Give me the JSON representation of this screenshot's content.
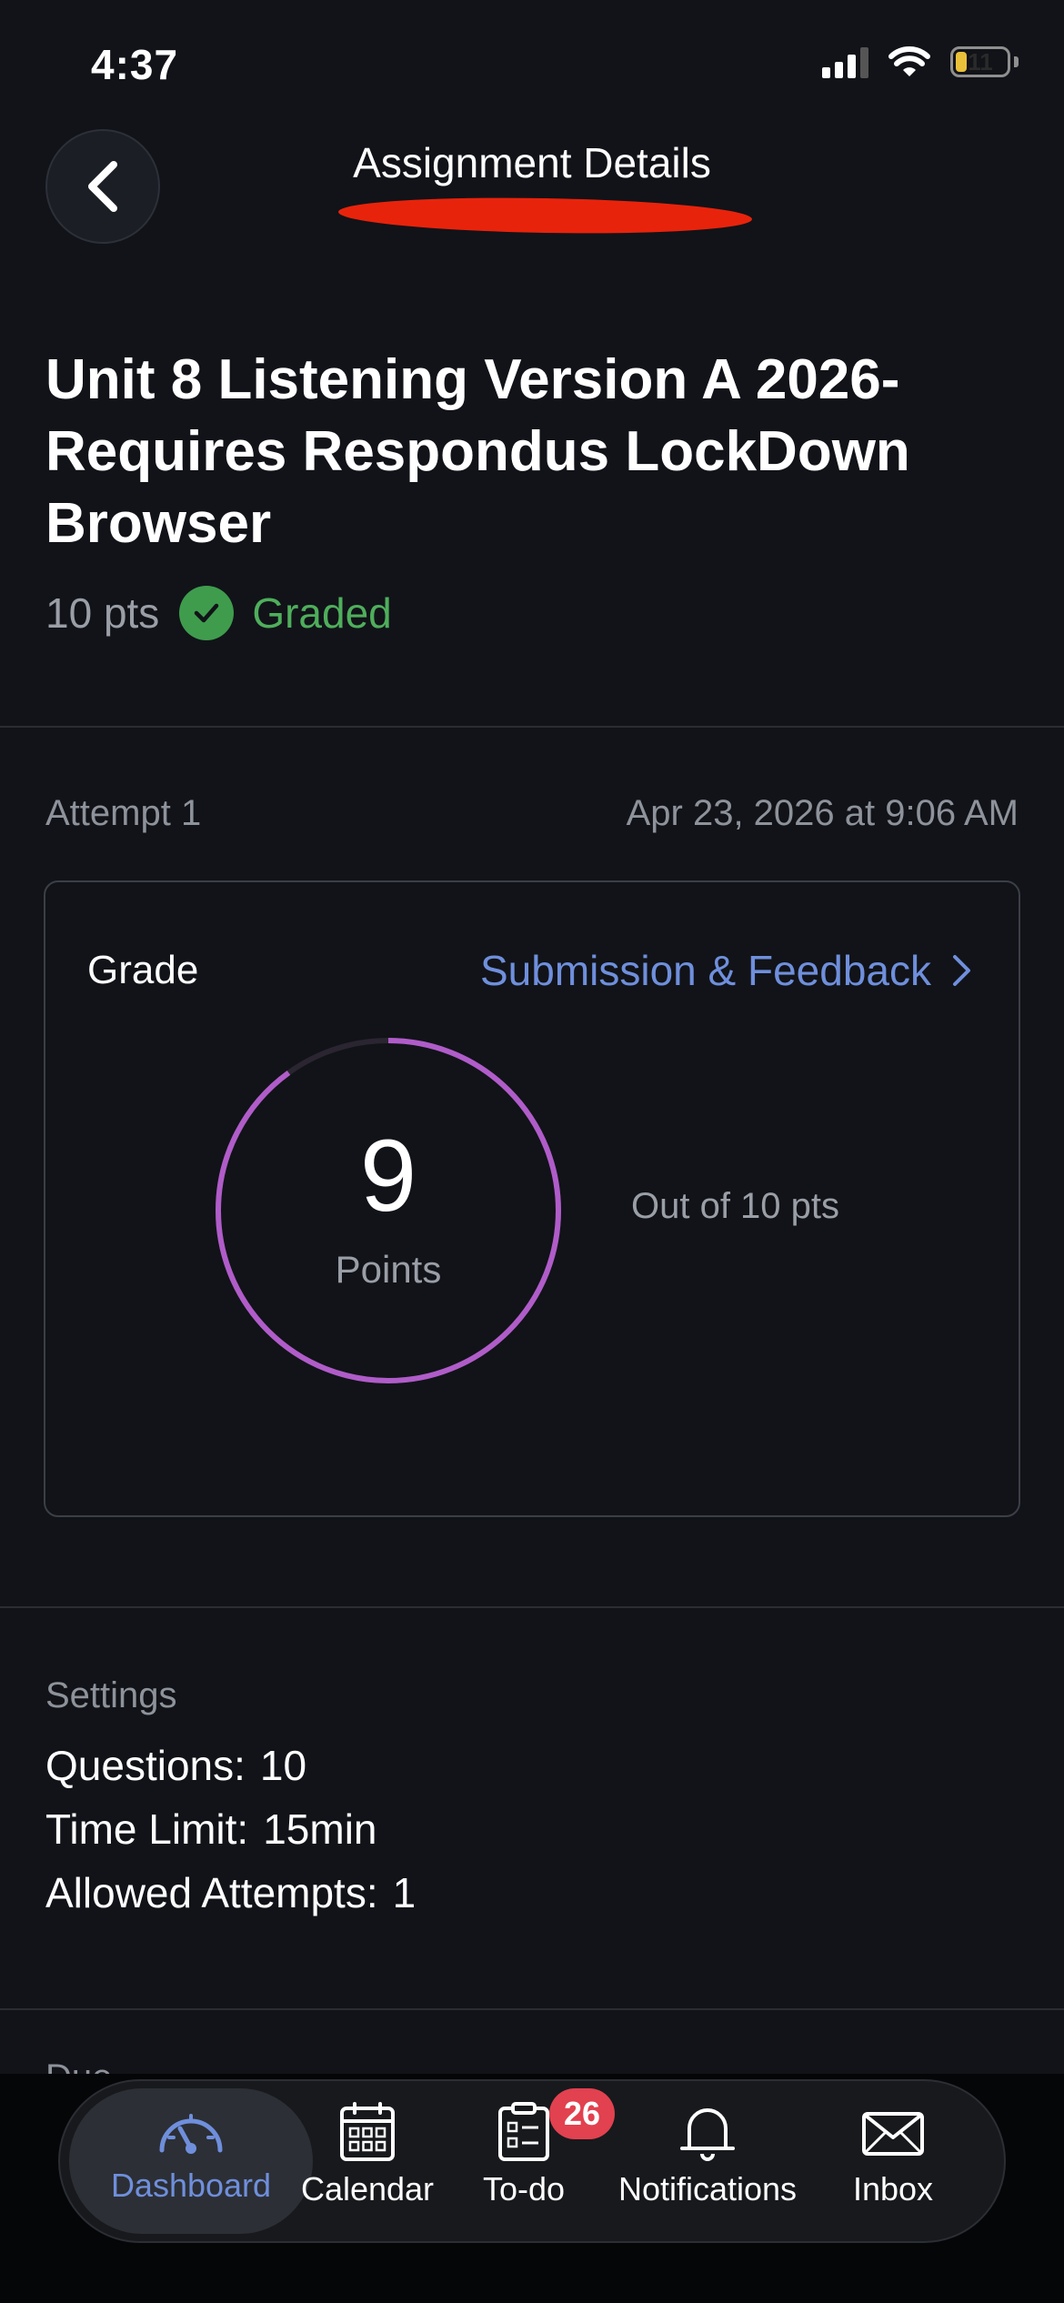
{
  "status_bar": {
    "time": "4:37",
    "battery_level": "11"
  },
  "header": {
    "title": "Assignment Details"
  },
  "assignment": {
    "title": "Unit 8 Listening Version A 2026-Requires Respondus LockDown Browser",
    "points": "10 pts",
    "status": "Graded"
  },
  "attempt": {
    "label": "Attempt 1",
    "date": "Apr 23, 2026 at 9:06 AM"
  },
  "grade_card": {
    "title": "Grade",
    "link_label": "Submission & Feedback",
    "score": "9",
    "score_unit": "Points",
    "out_of": "Out of 10 pts",
    "score_fraction": 0.9
  },
  "settings": {
    "label": "Settings",
    "rows": [
      {
        "key": "Questions:",
        "value": "10"
      },
      {
        "key": "Time Limit:",
        "value": "15min"
      },
      {
        "key": "Allowed Attempts:",
        "value": "1"
      }
    ]
  },
  "due": {
    "label": "Due"
  },
  "tab_bar": {
    "tabs": [
      {
        "label": "Dashboard",
        "icon": "dashboard-icon",
        "active": true
      },
      {
        "label": "Calendar",
        "icon": "calendar-icon"
      },
      {
        "label": "To-do",
        "icon": "todo-icon",
        "badge": "26"
      },
      {
        "label": "Notifications",
        "icon": "bell-icon"
      },
      {
        "label": "Inbox",
        "icon": "mail-icon"
      }
    ]
  },
  "colors": {
    "background": "#111318",
    "accent_blue": "#6f8fdc",
    "graded_green": "#4fae5c",
    "ring_purple": "#b05cc9",
    "badge_red": "#e2414f",
    "redaction_red": "#e8230c"
  }
}
